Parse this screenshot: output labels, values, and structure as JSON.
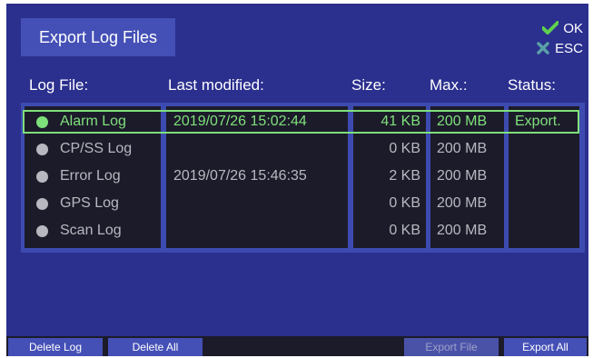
{
  "title": "Export Log Files",
  "hotkeys": [
    {
      "label": "OK",
      "icon": "check-icon",
      "color": "#5fcf4f"
    },
    {
      "label": "ESC",
      "icon": "x-icon",
      "color": "#5aa0a8"
    }
  ],
  "columns": {
    "log_file": "Log File:",
    "last_modified": "Last modified:",
    "size": "Size:",
    "max": "Max.:",
    "status": "Status:"
  },
  "rows": [
    {
      "name": "Alarm Log",
      "modified": "2019/07/26 15:02:44",
      "size": "41 KB",
      "max": "200 MB",
      "status": "Export."
    },
    {
      "name": "CP/SS Log",
      "modified": "",
      "size": "0 KB",
      "max": "200 MB",
      "status": ""
    },
    {
      "name": "Error Log",
      "modified": "2019/07/26 15:46:35",
      "size": "2 KB",
      "max": "200 MB",
      "status": ""
    },
    {
      "name": "GPS Log",
      "modified": "",
      "size": "0 KB",
      "max": "200 MB",
      "status": ""
    },
    {
      "name": "Scan Log",
      "modified": "",
      "size": "0 KB",
      "max": "200 MB",
      "status": ""
    }
  ],
  "selected_row": 0,
  "buttons": {
    "delete_log": "Delete Log",
    "delete_all": "Delete All",
    "export_file": "Export File",
    "export_all": "Export All"
  },
  "colors": {
    "background": "#2b2f8e",
    "accent": "#4450b6",
    "selected": "#7ee07a",
    "inactive_text": "#b8b8c0"
  }
}
